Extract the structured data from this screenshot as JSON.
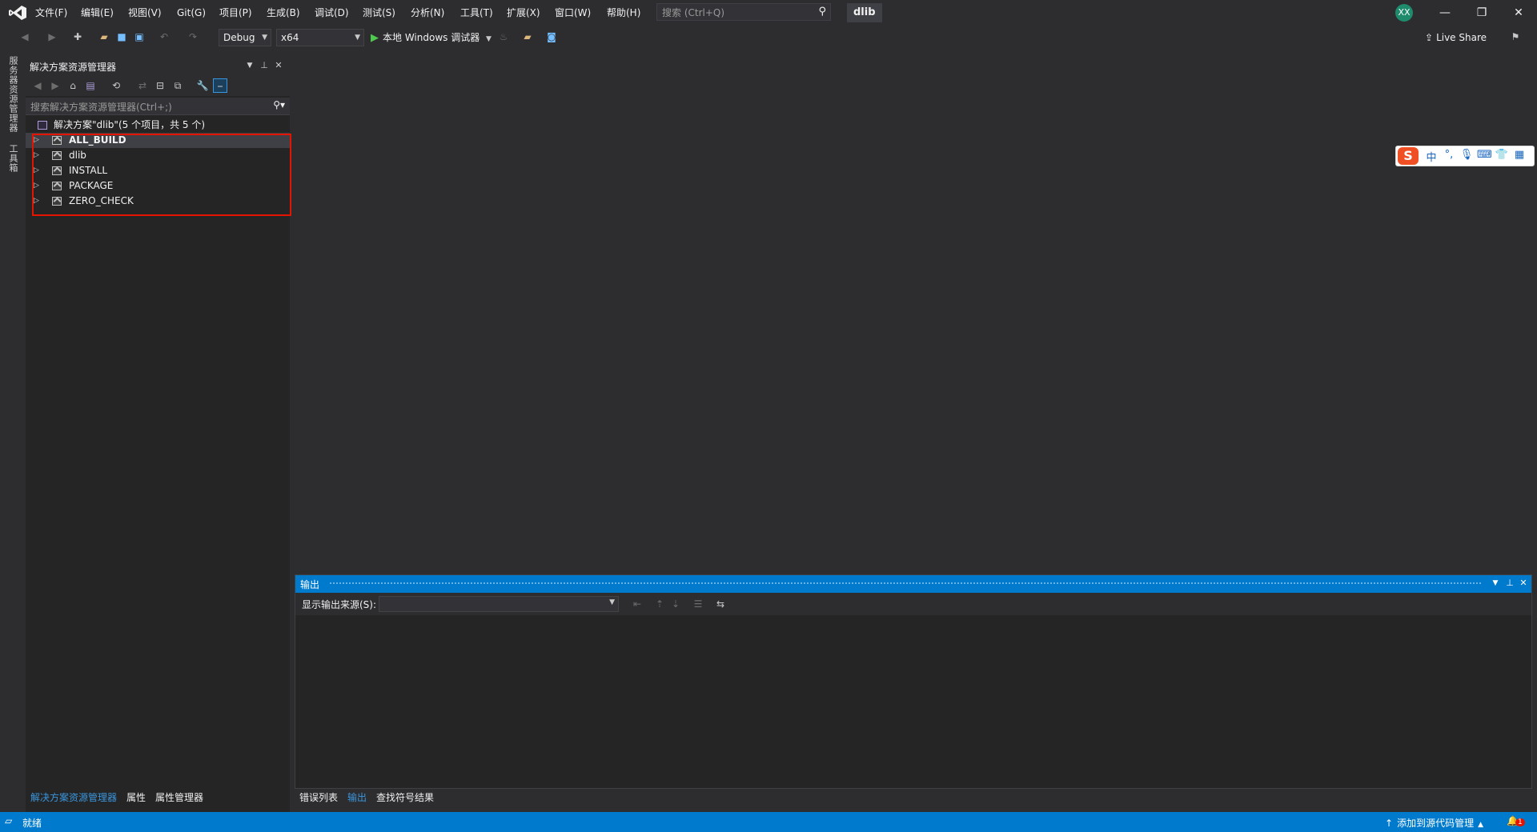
{
  "menu": [
    "文件(F)",
    "编辑(E)",
    "视图(V)",
    "Git(G)",
    "项目(P)",
    "生成(B)",
    "调试(D)",
    "测试(S)",
    "分析(N)",
    "工具(T)",
    "扩展(X)",
    "窗口(W)",
    "帮助(H)"
  ],
  "title_search": {
    "placeholder": "搜索 (Ctrl+Q)"
  },
  "doc_title": "dlib",
  "avatar_initials": "XX",
  "window_buttons": {
    "minimize": "—",
    "restore": "❐",
    "close": "✕"
  },
  "toolbar": {
    "config": "Debug",
    "platform": "x64",
    "run_label": "本地 Windows 调试器",
    "live_share": "Live Share"
  },
  "left_strip": {
    "tab1": "服务器资源管理器",
    "tab2": "工具箱"
  },
  "solution_explorer": {
    "title": "解决方案资源管理器",
    "search_placeholder": "搜索解决方案资源管理器(Ctrl+;)",
    "solution_label": "解决方案\"dlib\"(5 个项目，共 5 个)",
    "projects": [
      "ALL_BUILD",
      "dlib",
      "INSTALL",
      "PACKAGE",
      "ZERO_CHECK"
    ],
    "selected": "ALL_BUILD"
  },
  "left_bottom_tabs": [
    "解决方案资源管理器",
    "属性",
    "属性管理器"
  ],
  "output": {
    "title": "输出",
    "source_label": "显示输出来源(S):",
    "source_value": ""
  },
  "bottom_tabs": [
    "错误列表",
    "输出",
    "查找符号结果"
  ],
  "status": {
    "ready": "就绪",
    "source_control": "添加到源代码管理",
    "notifications": "1"
  },
  "ime": {
    "mode": "中"
  },
  "colors": {
    "accent": "#007acc",
    "highlight_box": "#e51400",
    "background": "#2d2d30",
    "panel": "#252526"
  }
}
